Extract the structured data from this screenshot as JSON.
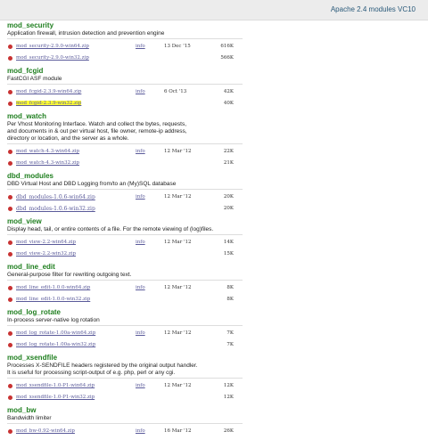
{
  "header": {
    "title": "Apache 2.4 modules VC10"
  },
  "modules": [
    {
      "name": "mod_security",
      "desc": [
        "Application firewall, intrusion detection and prevention engine"
      ],
      "files": [
        {
          "file": "mod_security-2.9.0-win64.zip",
          "info": "info",
          "date": "13 Dec '15",
          "size": "616K"
        },
        {
          "file": "mod_security-2.9.0-win32.zip",
          "info": "",
          "date": "",
          "size": "566K"
        }
      ]
    },
    {
      "name": "mod_fcgid",
      "desc": [
        "FastCGI ASF module"
      ],
      "files": [
        {
          "file": "mod_fcgid-2.3.9-win64.zip",
          "info": "info",
          "date": "6 Oct '13",
          "size": "42K"
        },
        {
          "file": "mod_fcgid-2.3.9-win32.zip",
          "info": "",
          "date": "",
          "size": "40K",
          "highlight": true
        }
      ]
    },
    {
      "name": "mod_watch",
      "desc": [
        "Per Vhost Monitoring Interface. Watch and collect the bytes, requests,",
        "and documents in & out per virtual host, file owner, remote-ip address,",
        "directory or location, and the server as a whole."
      ],
      "files": [
        {
          "file": "mod_watch-4.3-win64.zip",
          "info": "info",
          "date": "12 Mar '12",
          "size": "22K"
        },
        {
          "file": "mod_watch-4.3-win32.zip",
          "info": "",
          "date": "",
          "size": "21K"
        }
      ]
    },
    {
      "name": "dbd_modules",
      "desc": [
        "DBD Virtual Host and DBD Logging from/to an (My)SQL database"
      ],
      "files": [
        {
          "file": "dbd_modules-1.0.6-win64.zip",
          "info": "info",
          "date": "12 Mar '12",
          "size": "20K",
          "dbd": true
        },
        {
          "file": "dbd_modules-1.0.6-win32.zip",
          "info": "",
          "date": "",
          "size": "20K",
          "dbd": true
        }
      ]
    },
    {
      "name": "mod_view",
      "desc": [
        "Display head, tail, or entire contents of a file. For the remote viewing of (log)files."
      ],
      "files": [
        {
          "file": "mod_view-2.2-win64.zip",
          "info": "info",
          "date": "12 Mar '12",
          "size": "14K"
        },
        {
          "file": "mod_view-2.2-win32.zip",
          "info": "",
          "date": "",
          "size": "15K"
        }
      ]
    },
    {
      "name": "mod_line_edit",
      "desc": [
        "General-purpose filter for rewriting outgoing text."
      ],
      "files": [
        {
          "file": "mod_line_edit-1.0.0-win64.zip",
          "info": "info",
          "date": "12 Mar '12",
          "size": "8K"
        },
        {
          "file": "mod_line_edit-1.0.0-win32.zip",
          "info": "",
          "date": "",
          "size": "8K"
        }
      ]
    },
    {
      "name": "mod_log_rotate",
      "desc": [
        "In-process server-native log rotation"
      ],
      "files": [
        {
          "file": "mod_log_rotate-1.00a-win64.zip",
          "info": "info",
          "date": "12 Mar '12",
          "size": "7K"
        },
        {
          "file": "mod_log_rotate-1.00a-win32.zip",
          "info": "",
          "date": "",
          "size": "7K"
        }
      ]
    },
    {
      "name": "mod_xsendfile",
      "desc": [
        "Processes X-SENDFILE headers registered by the original output handler.",
        "It is useful for processing script-output of e.g. php, perl or any cgi."
      ],
      "files": [
        {
          "file": "mod_xsendfile-1.0-P1-win64.zip",
          "info": "info",
          "date": "12 Mar '12",
          "size": "12K"
        },
        {
          "file": "mod_xsendfile-1.0-P1-win32.zip",
          "info": "",
          "date": "",
          "size": "12K"
        }
      ]
    },
    {
      "name": "mod_bw",
      "desc": [
        "Bandwidth limiter"
      ],
      "files": [
        {
          "file": "mod_bw-0.92-win64.zip",
          "info": "info",
          "date": "16 Mar '12",
          "size": "26K"
        }
      ]
    }
  ]
}
